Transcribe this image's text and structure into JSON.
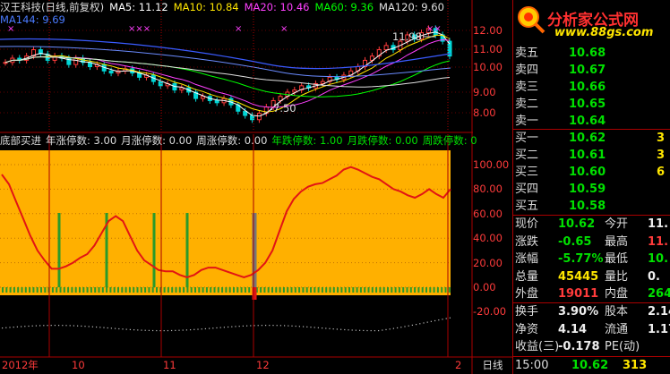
{
  "stock": {
    "name_period": "汉王科技(日线,前复权)",
    "ma_legend": [
      {
        "label": "MA5: 11.12",
        "color": "#ffffff"
      },
      {
        "label": "MA10: 10.84",
        "color": "#ffe600"
      },
      {
        "label": "MA20: 10.46",
        "color": "#ff40ff"
      },
      {
        "label": "MA60: 9.36",
        "color": "#00ff00"
      },
      {
        "label": "MA120: 9.60",
        "color": "#e0e0e0"
      }
    ],
    "ma144": "MA144: 9.69",
    "high_mark": "11.98",
    "low_mark": "7.50"
  },
  "indicator": {
    "items": [
      {
        "label": "底部买进",
        "color": "#dddddd"
      },
      {
        "label": "年涨停数: 3.00",
        "color": "#dddddd"
      },
      {
        "label": "月涨停数: 0.00",
        "color": "#dddddd"
      },
      {
        "label": "周涨停数: 0.00",
        "color": "#dddddd"
      },
      {
        "label": "年跌停数: 1.00",
        "color": "#00e000"
      },
      {
        "label": "月跌停数: 0.00",
        "color": "#00e000"
      },
      {
        "label": "周跌停数: 0",
        "color": "#00e000"
      }
    ]
  },
  "price_axis": [
    "12.00",
    "11.00",
    "10.00",
    "9.00",
    "8.00"
  ],
  "ind_axis": [
    "100.00",
    "80.00",
    "60.00",
    "40.00",
    "20.00",
    "0.00",
    "-20.00"
  ],
  "x_labels": [
    "2012年",
    "10",
    "11",
    "12",
    "2"
  ],
  "period_label": "日线",
  "logo": {
    "title": "分析家公式网",
    "url": "www.88gs.com"
  },
  "asks": [
    {
      "label": "卖五",
      "price": "10.68",
      "vol": ""
    },
    {
      "label": "卖四",
      "price": "10.67",
      "vol": ""
    },
    {
      "label": "卖三",
      "price": "10.66",
      "vol": ""
    },
    {
      "label": "卖二",
      "price": "10.65",
      "vol": ""
    },
    {
      "label": "卖一",
      "price": "10.64",
      "vol": ""
    }
  ],
  "bids": [
    {
      "label": "买一",
      "price": "10.62",
      "vol": "3"
    },
    {
      "label": "买二",
      "price": "10.61",
      "vol": "3"
    },
    {
      "label": "买三",
      "price": "10.60",
      "vol": "6"
    },
    {
      "label": "买四",
      "price": "10.59",
      "vol": ""
    },
    {
      "label": "买五",
      "price": "10.58",
      "vol": ""
    }
  ],
  "quote": [
    {
      "l1": "现价",
      "v1": "10.62",
      "c1": "green",
      "l2": "今开",
      "v2": "11.",
      "c2": "white"
    },
    {
      "l1": "涨跌",
      "v1": "-0.65",
      "c1": "green",
      "l2": "最高",
      "v2": "11.",
      "c2": "red"
    },
    {
      "l1": "涨幅",
      "v1": "-5.77%",
      "c1": "green",
      "l2": "最低",
      "v2": "10.",
      "c2": "green"
    },
    {
      "l1": "总量",
      "v1": "45445",
      "c1": "yellow",
      "l2": "量比",
      "v2": "0.",
      "c2": "white"
    },
    {
      "l1": "外盘",
      "v1": "19011",
      "c1": "red",
      "l2": "内盘",
      "v2": "264",
      "c2": "green"
    }
  ],
  "fund": [
    {
      "l1": "换手",
      "v1": "3.90%",
      "c1": "white",
      "l2": "股本",
      "v2": "2.14",
      "c2": "white"
    },
    {
      "l1": "净资",
      "v1": "4.14",
      "c1": "white",
      "l2": "流通",
      "v2": "1.17",
      "c2": "white"
    },
    {
      "l1": "收益(三)",
      "v1": "-0.178",
      "c1": "white",
      "l2": "PE(动)",
      "v2": "",
      "c2": "white"
    }
  ],
  "tick": {
    "time": "15:00",
    "price": "10.62",
    "vol": "313"
  },
  "chart_data": {
    "type": "line",
    "indicator_ylim": [
      -20,
      110
    ],
    "indicator_line": [
      92,
      84,
      70,
      56,
      42,
      30,
      22,
      15,
      15,
      17,
      20,
      24,
      27,
      34,
      44,
      54,
      58,
      54,
      42,
      30,
      22,
      18,
      14,
      13,
      13,
      10,
      8,
      10,
      14,
      16,
      16,
      14,
      12,
      10,
      8,
      10,
      14,
      20,
      30,
      46,
      62,
      72,
      78,
      82,
      84,
      85,
      88,
      91,
      96,
      98,
      96,
      93,
      90,
      88,
      84,
      80,
      78,
      75,
      73,
      76,
      80,
      76,
      73,
      80
    ],
    "signal_bars": [
      9,
      15,
      25,
      31,
      40
    ],
    "price_close": [
      10.3,
      10.5,
      10.4,
      10.6,
      10.9,
      10.7,
      10.4,
      10.6,
      10.5,
      10.2,
      10.5,
      10.3,
      10.1,
      10.2,
      9.9,
      9.8,
      9.9,
      10.0,
      9.8,
      9.6,
      9.7,
      9.4,
      9.2,
      9.3,
      9.0,
      9.1,
      8.9,
      8.6,
      8.7,
      8.5,
      8.4,
      8.6,
      8.3,
      8.0,
      7.8,
      7.6,
      7.9,
      8.2,
      8.5,
      8.7,
      8.9,
      9.0,
      9.2,
      9.1,
      9.3,
      9.4,
      9.6,
      9.5,
      9.7,
      9.9,
      10.1,
      10.4,
      10.6,
      10.9,
      11.1,
      10.9,
      11.3,
      11.6,
      11.4,
      11.7,
      11.9,
      11.6,
      11.3,
      10.6
    ]
  }
}
